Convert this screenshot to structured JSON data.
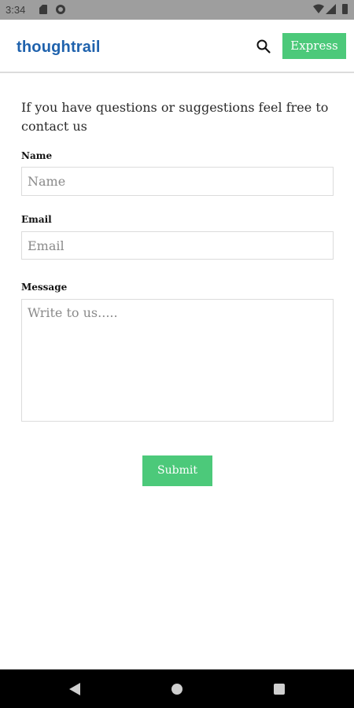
{
  "status_bar": {
    "time": "3:34",
    "icons": [
      "sd-card-icon",
      "g-icon",
      "wifi-icon",
      "signal-icon",
      "battery-icon"
    ]
  },
  "header": {
    "logo": "thoughtrail",
    "express_label": "Express",
    "search_icon": "search-icon"
  },
  "form": {
    "intro": "If you have questions or suggestions feel free to contact us",
    "name_label": "Name",
    "name_placeholder": "Name",
    "email_label": "Email",
    "email_placeholder": "Email",
    "message_label": "Message",
    "message_placeholder": "Write to us.....",
    "submit_label": "Submit"
  },
  "nav_bar": {
    "icons": [
      "back-icon",
      "home-icon",
      "recents-icon"
    ]
  },
  "colors": {
    "brand_blue": "#1f62ad",
    "accent_green": "#4cc97a",
    "status_bar": "#9e9e9e",
    "nav_bar": "#000000"
  }
}
